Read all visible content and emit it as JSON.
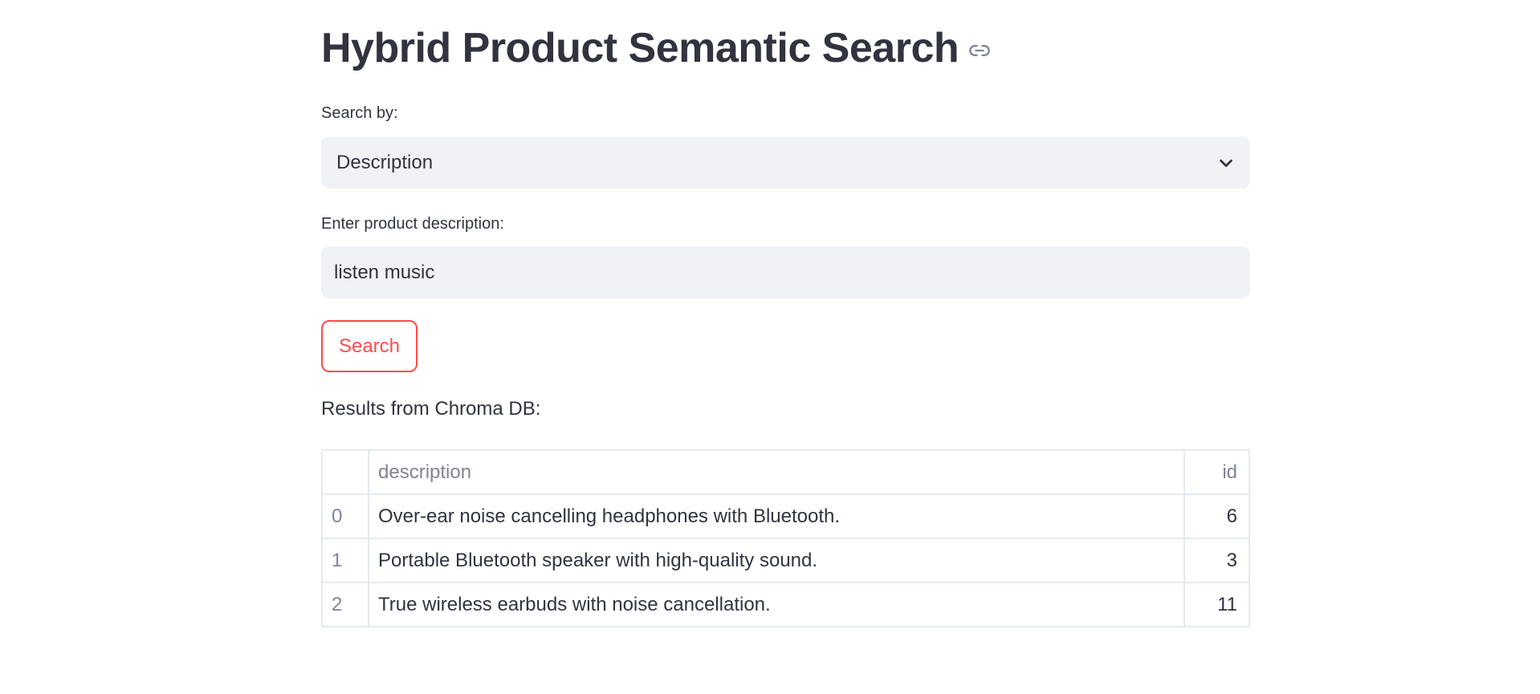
{
  "page": {
    "title": "Hybrid Product Semantic Search",
    "link_icon": "link-icon"
  },
  "search_by": {
    "label": "Search by:",
    "selected": "Description",
    "icon": "chevron-down-icon"
  },
  "description_input": {
    "label": "Enter product description:",
    "value": "listen music"
  },
  "search_button": {
    "label": "Search"
  },
  "results": {
    "label": "Results from Chroma DB:",
    "columns": [
      "",
      "description",
      "id"
    ],
    "rows": [
      {
        "index": "0",
        "description": "Over-ear noise cancelling headphones with Bluetooth.",
        "id": "6"
      },
      {
        "index": "1",
        "description": "Portable Bluetooth speaker with high-quality sound.",
        "id": "3"
      },
      {
        "index": "2",
        "description": "True wireless earbuds with noise cancellation.",
        "id": "11"
      }
    ]
  },
  "colors": {
    "text": "#31333f",
    "muted": "#808495",
    "input_bg": "#f0f2f6",
    "accent": "#ff4b4b",
    "border": "#e6e9ef"
  }
}
